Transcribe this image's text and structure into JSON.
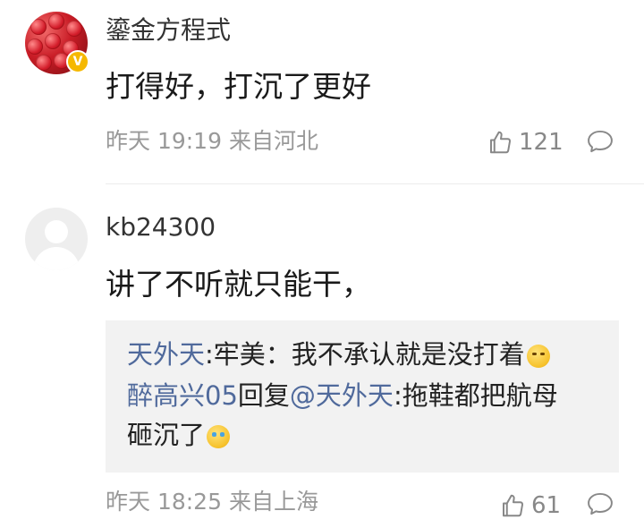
{
  "comments": [
    {
      "username": "鎏金方程式",
      "verified_badge": "V",
      "text": "打得好，打沉了更好",
      "meta": "昨天 19:19 来自河北",
      "likes": "121"
    },
    {
      "username": "kb24300",
      "text": "讲了不听就只能干，",
      "quote": {
        "line1_user": "天外天",
        "line1_sep": ":",
        "line1_text": "牢美：我不承认就是没打着",
        "line2_user": "醉高兴05",
        "line2_action": "回复",
        "line2_mention": "@天外天",
        "line2_sep": ":",
        "line2_text": "拖鞋都把航母",
        "line3_text": "砸沉了"
      },
      "meta": "昨天 18:25 来自上海",
      "likes": "61"
    }
  ],
  "icons": {
    "like": "thumbs-up-icon",
    "reply": "comment-bubble-icon",
    "emoji_1": "thinking-face-emoji",
    "emoji_2": "laughing-crying-emoji"
  },
  "colors": {
    "link": "#506a9c",
    "meta": "#999999",
    "badge": "#f5b800",
    "quote_bg": "#f2f2f2"
  }
}
